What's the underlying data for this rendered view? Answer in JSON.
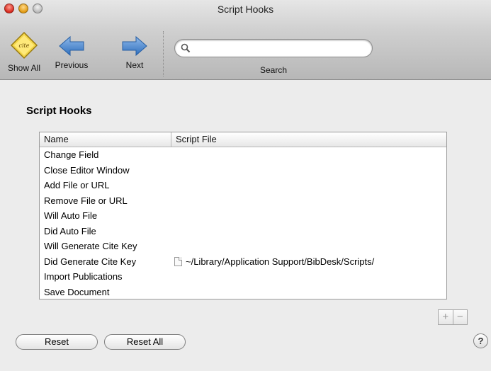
{
  "window": {
    "title": "Script Hooks"
  },
  "toolbar": {
    "show_all_label": "Show All",
    "previous_label": "Previous",
    "next_label": "Next",
    "search_label": "Search",
    "search_value": "",
    "show_all_icon_text": "cite",
    "accent_color": "#3a7fcc"
  },
  "pane": {
    "title": "Script Hooks"
  },
  "table": {
    "columns": [
      "Name",
      "Script File"
    ],
    "rows": [
      {
        "name": "Change Field",
        "file": ""
      },
      {
        "name": "Close Editor Window",
        "file": ""
      },
      {
        "name": "Add File or URL",
        "file": ""
      },
      {
        "name": "Remove File or URL",
        "file": ""
      },
      {
        "name": "Will Auto File",
        "file": ""
      },
      {
        "name": "Did Auto File",
        "file": ""
      },
      {
        "name": "Will Generate Cite Key",
        "file": ""
      },
      {
        "name": "Did Generate Cite Key",
        "file": "~/Library/Application Support/BibDesk/Scripts/"
      },
      {
        "name": "Import Publications",
        "file": ""
      },
      {
        "name": "Save Document",
        "file": ""
      }
    ]
  },
  "buttons": {
    "add": "+",
    "remove": "−",
    "reset": "Reset",
    "reset_all": "Reset All",
    "help": "?"
  }
}
